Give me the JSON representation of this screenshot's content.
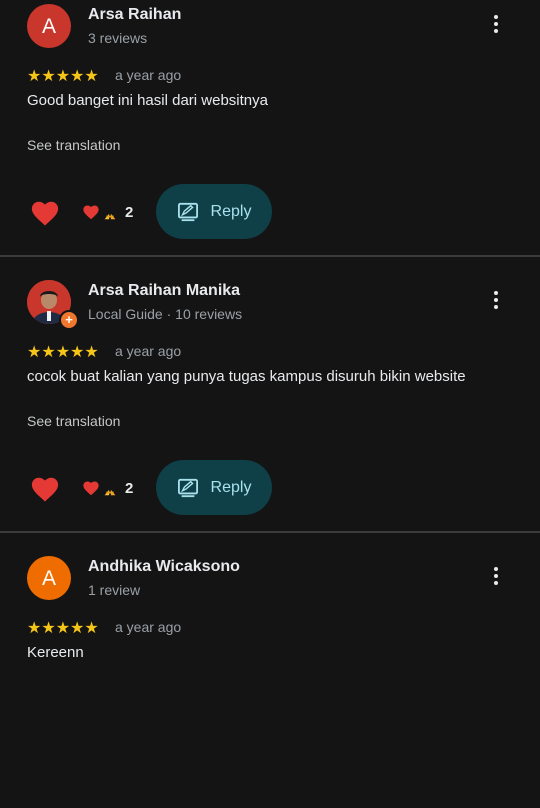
{
  "reviews": [
    {
      "avatar_letter": "A",
      "avatar_color": "#c9362b",
      "name": "Arsa Raihan",
      "meta": "3 reviews",
      "stars": "★★★★★",
      "time": "a year ago",
      "text": "Good banget ini hasil dari websitnya",
      "translate": "See translation",
      "reaction_count": "2",
      "reply": "Reply"
    },
    {
      "avatar_letter": "",
      "avatar_color": "#c9362b",
      "name": "Arsa Raihan Manika",
      "meta": "Local Guide · 10 reviews",
      "stars": "★★★★★",
      "time": "a year ago",
      "text": "cocok buat kalian yang punya tugas kampus disuruh bikin website",
      "translate": "See translation",
      "reaction_count": "2",
      "reply": "Reply"
    },
    {
      "avatar_letter": "A",
      "avatar_color": "#ef6c00",
      "name": "Andhika Wicaksono",
      "meta": "1 review",
      "stars": "★★★★★",
      "time": "a year ago",
      "text": "Kereenn"
    }
  ],
  "colors": {
    "background": "#141414",
    "star": "#f5c518",
    "reply_bg": "#0f3f47",
    "reply_text": "#a8e2ec",
    "heart": "#e53935"
  },
  "icons": {
    "heart": "heart-icon",
    "pray": "pray-emoji-icon",
    "reply": "reply-edit-icon",
    "more": "more-vert-icon",
    "local_guide": "local-guide-badge-icon"
  }
}
